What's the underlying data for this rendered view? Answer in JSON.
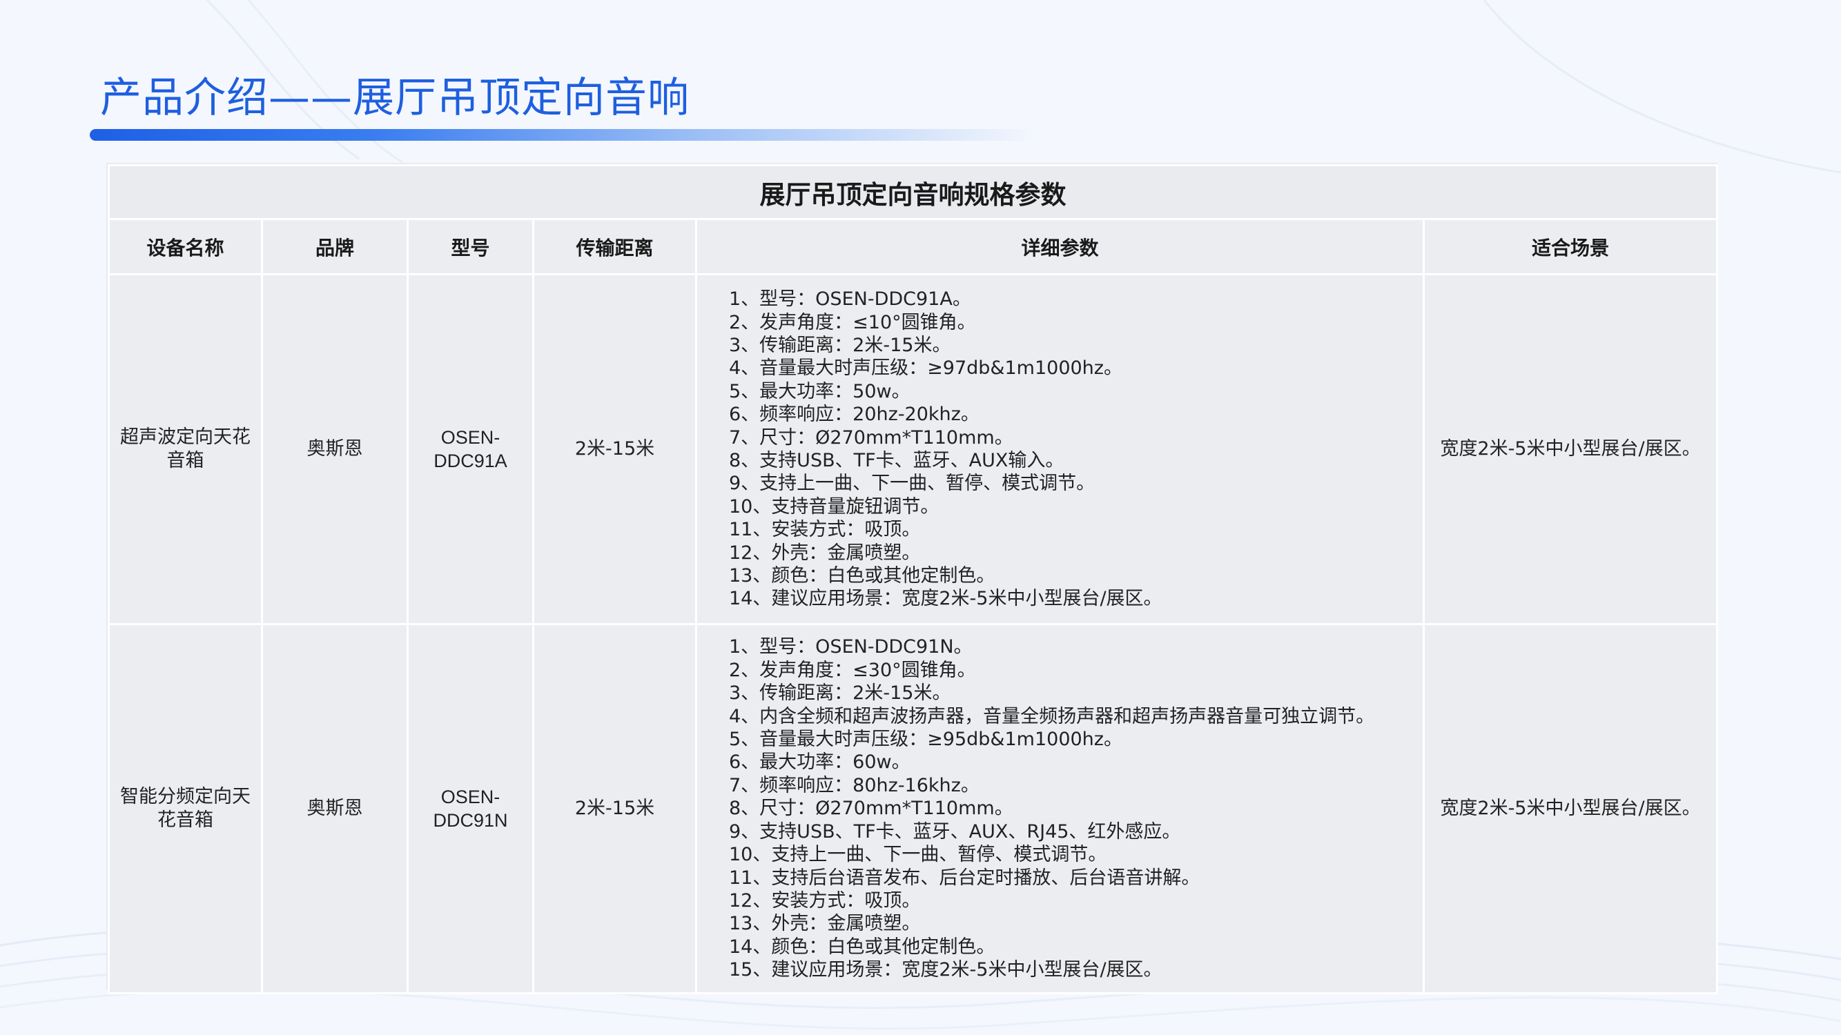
{
  "page": {
    "title": "产品介绍——展厅吊顶定向音响"
  },
  "colors": {
    "title": "#1e5fe0",
    "accent_bar": "#1f5fe6",
    "cell_bg": "#ebedf1",
    "background": "#f4f7fd"
  },
  "table": {
    "caption": "展厅吊顶定向音响规格参数",
    "headers": [
      "设备名称",
      "品牌",
      "型号",
      "传输距离",
      "详细参数",
      "适合场景"
    ],
    "rows": [
      {
        "name": "超声波定向天花音箱",
        "brand": "奥斯恩",
        "model": "OSEN-DDC91A",
        "distance": "2米-15米",
        "details": [
          "1、型号：OSEN-DDC91A。",
          "2、发声角度：≤10°圆锥角。",
          "3、传输距离：2米-15米。",
          "4、音量最大时声压级：≥97db&1m1000hz。",
          "5、最大功率：50w。",
          "6、频率响应：20hz-20khz。",
          "7、尺寸：Ø270mm*T110mm。",
          "8、支持USB、TF卡、蓝牙、AUX输入。",
          "9、支持上一曲、下一曲、暂停、模式调节。",
          "10、支持音量旋钮调节。",
          "11、安装方式：吸顶。",
          "12、外壳：金属喷塑。",
          "13、颜色：白色或其他定制色。",
          "14、建议应用场景：宽度2米-5米中小型展台/展区。"
        ],
        "scene": "宽度2米-5米中小型展台/展区。"
      },
      {
        "name": "智能分频定向天花音箱",
        "brand": "奥斯恩",
        "model": "OSEN-DDC91N",
        "distance": "2米-15米",
        "details": [
          "1、型号：OSEN-DDC91N。",
          "2、发声角度：≤30°圆锥角。",
          "3、传输距离：2米-15米。",
          "4、内含全频和超声波扬声器，音量全频扬声器和超声扬声器音量可独立调节。",
          "5、音量最大时声压级：≥95db&1m1000hz。",
          "6、最大功率：60w。",
          "7、频率响应：80hz-16khz。",
          "8、尺寸：Ø270mm*T110mm。",
          "9、支持USB、TF卡、蓝牙、AUX、RJ45、红外感应。",
          "10、支持上一曲、下一曲、暂停、模式调节。",
          "11、支持后台语音发布、后台定时播放、后台语音讲解。",
          "12、安装方式：吸顶。",
          "13、外壳：金属喷塑。",
          "14、颜色：白色或其他定制色。",
          "15、建议应用场景：宽度2米-5米中小型展台/展区。"
        ],
        "scene": "宽度2米-5米中小型展台/展区。"
      }
    ]
  }
}
